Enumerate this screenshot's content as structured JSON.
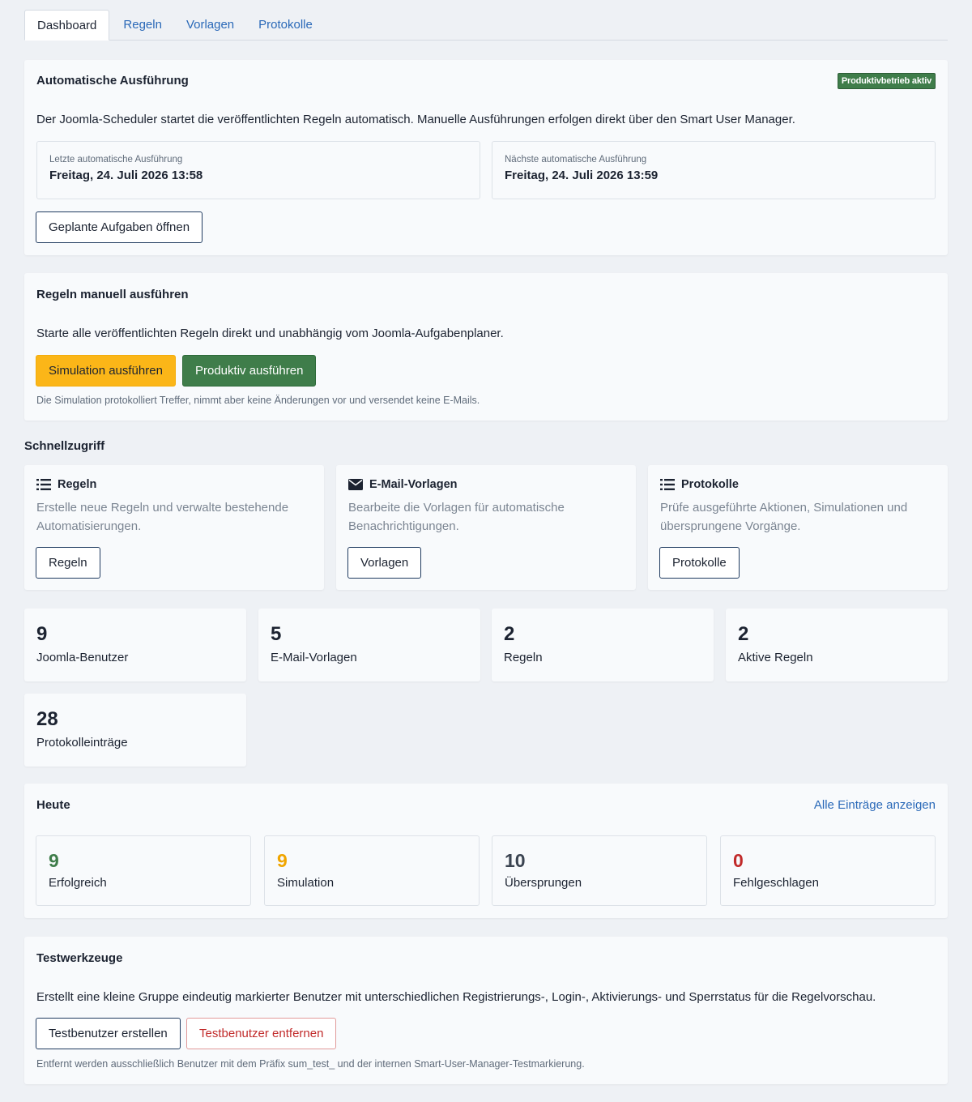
{
  "tabs": [
    {
      "label": "Dashboard",
      "active": true
    },
    {
      "label": "Regeln"
    },
    {
      "label": "Vorlagen"
    },
    {
      "label": "Protokolle"
    }
  ],
  "auto": {
    "title": "Automatische Ausführung",
    "badge": "Produktivbetrieb aktiv",
    "description": "Der Joomla-Scheduler startet die veröffentlichten Regeln automatisch. Manuelle Ausführungen erfolgen direkt über den Smart User Manager.",
    "last_label": "Letzte automatische Ausführung",
    "last_value": "Freitag, 24. Juli 2026 13:58",
    "next_label": "Nächste automatische Ausführung",
    "next_value": "Freitag, 24. Juli 2026 13:59",
    "button": "Geplante Aufgaben öffnen"
  },
  "manual": {
    "title": "Regeln manuell ausführen",
    "description": "Starte alle veröffentlichten Regeln direkt und unabhängig vom Joomla-Aufgabenplaner.",
    "sim_button": "Simulation ausführen",
    "prod_button": "Produktiv ausführen",
    "note": "Die Simulation protokolliert Treffer, nimmt aber keine Änderungen vor und versendet keine E-Mails."
  },
  "quick": {
    "title": "Schnellzugriff",
    "items": [
      {
        "icon": "list-icon",
        "title": "Regeln",
        "description": "Erstelle neue Regeln und verwalte bestehende Automatisierungen.",
        "button": "Regeln"
      },
      {
        "icon": "envelope-icon",
        "title": "E-Mail-Vorlagen",
        "description": "Bearbeite die Vorlagen für automatische Benachrichtigungen.",
        "button": "Vorlagen"
      },
      {
        "icon": "list-icon",
        "title": "Protokolle",
        "description": "Prüfe ausgeführte Aktionen, Simulationen und übersprungene Vorgänge.",
        "button": "Protokolle"
      }
    ]
  },
  "stats": [
    {
      "value": "9",
      "label": "Joomla-Benutzer"
    },
    {
      "value": "5",
      "label": "E-Mail-Vorlagen"
    },
    {
      "value": "2",
      "label": "Regeln"
    },
    {
      "value": "2",
      "label": "Aktive Regeln"
    },
    {
      "value": "28",
      "label": "Protokolleinträge"
    }
  ],
  "today": {
    "title": "Heute",
    "link": "Alle Einträge anzeigen",
    "items": [
      {
        "value": "9",
        "label": "Erfolgreich",
        "color": "#3f7d4a"
      },
      {
        "value": "9",
        "label": "Simulation",
        "color": "#f0a500"
      },
      {
        "value": "10",
        "label": "Übersprungen",
        "color": "#3b4451"
      },
      {
        "value": "0",
        "label": "Fehlgeschlagen",
        "color": "#c12a2a"
      }
    ]
  },
  "tools": {
    "title": "Testwerkzeuge",
    "description": "Erstellt eine kleine Gruppe eindeutig markierter Benutzer mit unterschiedlichen Registrierungs-, Login-, Aktivierungs- und Sperrstatus für die Regelvorschau.",
    "create_button": "Testbenutzer erstellen",
    "remove_button": "Testbenutzer entfernen",
    "note": "Entfernt werden ausschließlich Benutzer mit dem Präfix sum_test_ und der internen Smart-User-Manager-Testmarkierung."
  },
  "colors": {
    "accent": "#2a69b8",
    "success": "#3f7d4a",
    "warning": "#fbb618",
    "danger": "#c12a2a"
  }
}
